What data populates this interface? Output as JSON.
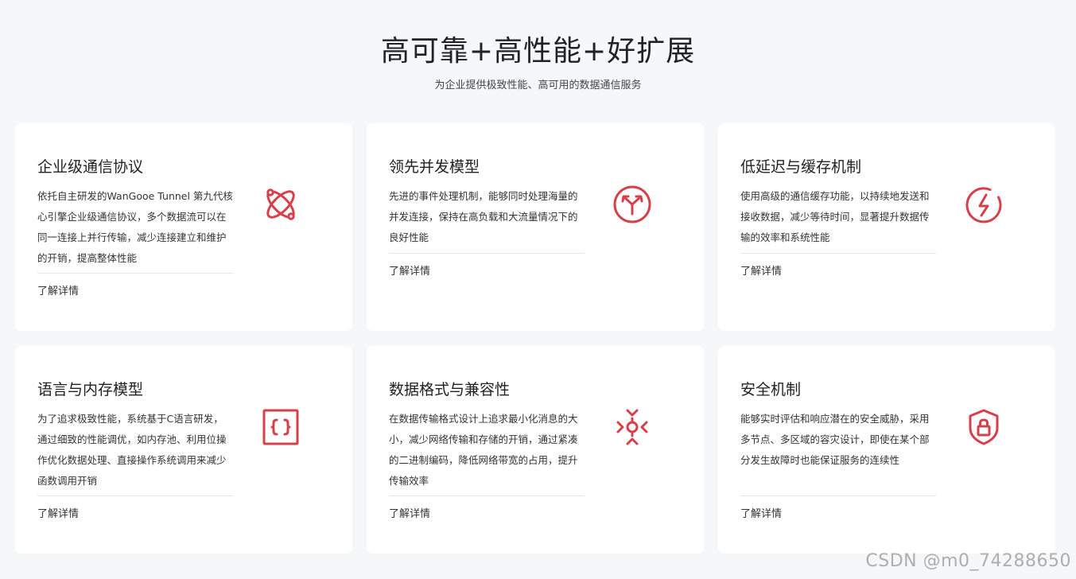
{
  "header": {
    "title": "高可靠+高性能+好扩展",
    "subtitle": "为企业提供极致性能、高可用的数据通信服务"
  },
  "accent_color": "#d6404b",
  "cards": [
    {
      "title": "企业级通信协议",
      "desc": "依托自主研发的WanGooe Tunnel 第九代核心引擎企业级通信协议，多个数据流可以在同一连接上并行传输，减少连接建立和维护的开销，提高整体性能",
      "link": "了解详情",
      "icon": "atom-icon"
    },
    {
      "title": "领先并发模型",
      "desc": "先进的事件处理机制，能够同时处理海量的并发连接，保持在高负载和大流量情况下的良好性能",
      "link": "了解详情",
      "icon": "split-arrows-icon"
    },
    {
      "title": "低延迟与缓存机制",
      "desc": "使用高级的通信缓存功能，以持续地发送和接收数据，减少等待时间，显著提升数据传输的效率和系统性能",
      "link": "了解详情",
      "icon": "lightning-icon"
    },
    {
      "title": "语言与内存模型",
      "desc": "为了追求极致性能，系统基于C语言研发，通过细致的性能调优，如内存池、利用位操作优化数据处理、直接操作系统调用来减少函数调用开销",
      "link": "了解详情",
      "icon": "code-braces-icon"
    },
    {
      "title": "数据格式与兼容性",
      "desc": "在数据传输格式设计上追求最小化消息的大小，减少网络传输和存储的开销，通过紧凑的二进制编码，降低网络带宽的占用，提升传输效率",
      "link": "了解详情",
      "icon": "compress-icon"
    },
    {
      "title": "安全机制",
      "desc": "能够实时评估和响应潜在的安全威胁，采用多节点、多区域的容灾设计，即使在某个部分发生故障时也能保证服务的连续性",
      "link": "了解详情",
      "icon": "shield-lock-icon"
    }
  ],
  "watermark": "CSDN @m0_74288650"
}
